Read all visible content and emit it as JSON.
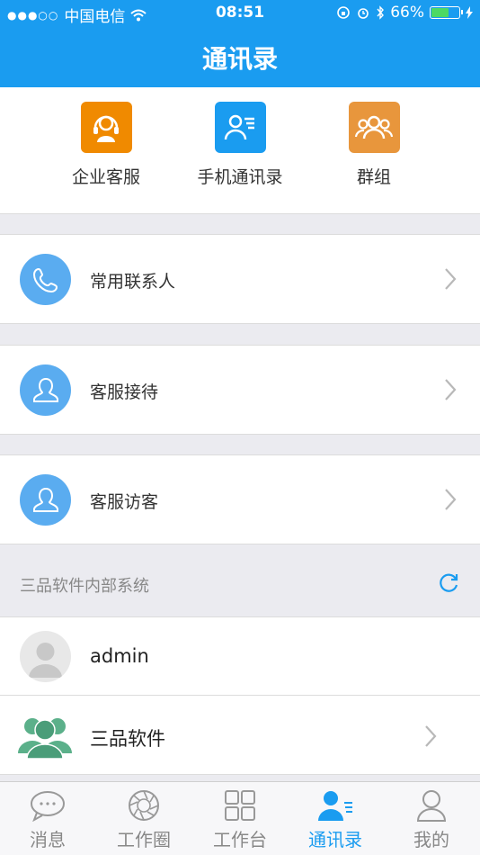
{
  "status_bar": {
    "carrier": "中国电信",
    "signal_dots": "●●●○○",
    "time": "08:51",
    "battery_percent": "66%",
    "battery_level": 0.66
  },
  "nav": {
    "title": "通讯录"
  },
  "quick_actions": [
    {
      "label": "企业客服",
      "icon": "headset-icon",
      "color": "#f08a00"
    },
    {
      "label": "手机通讯录",
      "icon": "contact-card-icon",
      "color": "#1a9cf0"
    },
    {
      "label": "群组",
      "icon": "group-icon",
      "color": "#e8963c"
    }
  ],
  "menu_rows": [
    {
      "label": "常用联系人",
      "icon": "phone-icon"
    },
    {
      "label": "客服接待",
      "icon": "person-icon"
    },
    {
      "label": "客服访客",
      "icon": "person-icon"
    }
  ],
  "section": {
    "title": "三品软件内部系统",
    "icon": "refresh-icon"
  },
  "contacts": [
    {
      "name": "admin",
      "icon": "default-avatar-icon"
    },
    {
      "name": "三品软件",
      "icon": "group-avatar-icon"
    }
  ],
  "tabs": [
    {
      "label": "消息",
      "icon": "chat-bubble-icon",
      "active": false
    },
    {
      "label": "工作圈",
      "icon": "aperture-icon",
      "active": false
    },
    {
      "label": "工作台",
      "icon": "grid-icon",
      "active": false
    },
    {
      "label": "通讯录",
      "icon": "contacts-icon",
      "active": true
    },
    {
      "label": "我的",
      "icon": "user-icon",
      "active": false
    }
  ],
  "colors": {
    "primary": "#1a9cf0",
    "row_icon_bg": "#5aacf0",
    "group_green": "#5bb08a"
  }
}
